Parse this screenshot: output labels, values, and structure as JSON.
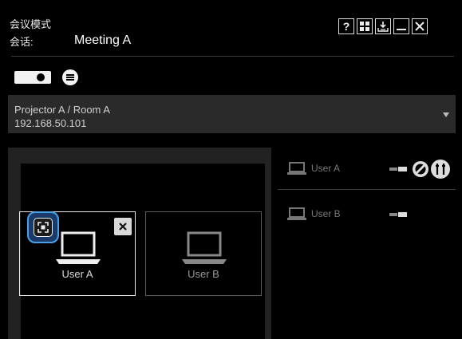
{
  "header": {
    "mode_label": "会议模式",
    "session_label": "会话:",
    "session_name": "Meeting A"
  },
  "window_controls": [
    {
      "name": "help-button",
      "label": "?"
    },
    {
      "name": "layout-button",
      "icon": "grid-icon"
    },
    {
      "name": "download-button",
      "icon": "download-icon"
    },
    {
      "name": "minimize-button",
      "icon": "minimize-icon"
    },
    {
      "name": "close-button",
      "icon": "close-icon"
    }
  ],
  "toolbar": {
    "projector_icon": "projector-icon",
    "list_icon": "list-icon"
  },
  "projector_selector": {
    "name": "Projector A / Room A",
    "ip": "192.168.50.101"
  },
  "stage": {
    "tiles": [
      {
        "label": "User A",
        "active": true
      },
      {
        "label": "User B",
        "active": false
      }
    ]
  },
  "users": [
    {
      "name": "User A",
      "icons": [
        "laptop-icon",
        "toggle-icon",
        "block-icon",
        "tools-icon"
      ]
    },
    {
      "name": "User B",
      "icons": [
        "laptop-icon",
        "toggle-icon"
      ]
    }
  ],
  "colors": {
    "accent": "#4aa0e6",
    "background": "#000000",
    "panel": "#2a2a2a"
  }
}
